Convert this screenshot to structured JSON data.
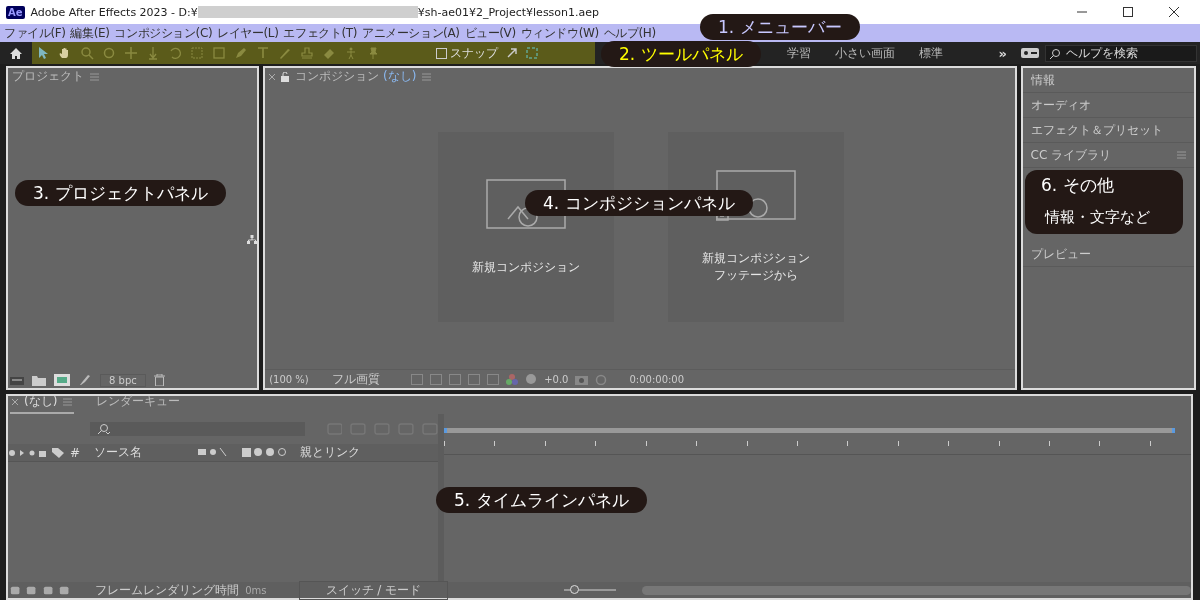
{
  "window": {
    "app_badge": "Ae",
    "title_prefix": "Adobe After Effects 2023 - D:¥",
    "title_suffix": "¥sh-ae01¥2_Project¥lesson1.aep"
  },
  "menu_bar": {
    "items": [
      "ファイル(F)",
      "編集(E)",
      "コンポジション(C)",
      "レイヤー(L)",
      "エフェクト(T)",
      "アニメーション(A)",
      "ビュー(V)",
      "ウィンドウ(W)",
      "ヘルプ(H)"
    ]
  },
  "tool_panel": {
    "snap_label": "スナップ",
    "snap_checked": false,
    "workspaces": [
      {
        "label": "学習",
        "selected": false
      },
      {
        "label": "小さい画面",
        "selected": false
      },
      {
        "label": "標準",
        "selected": false
      }
    ],
    "more": "»",
    "help_search": {
      "placeholder": "ヘルプを検索"
    }
  },
  "project_panel": {
    "title": "プロジェクト",
    "bit_depth": "8 bpc"
  },
  "composition_panel": {
    "tab": "コンポジション",
    "tab_comp": "(なし)",
    "cards": [
      {
        "lines": [
          "新規コンポジション"
        ]
      },
      {
        "lines": [
          "新規コンポジション",
          "フッテージから"
        ]
      }
    ],
    "zoom": "(100 %)",
    "resolution": "フル画質",
    "exposure": "+0.0",
    "timecode": "0:00:00:00"
  },
  "side_panels": {
    "items": [
      {
        "label": "情報",
        "menu": false
      },
      {
        "label": "オーディオ",
        "menu": false
      },
      {
        "label": "エフェクト＆プリセット",
        "menu": false
      },
      {
        "label": "CC ライブラリ",
        "menu": true
      },
      {
        "label": "プレビュー",
        "menu": false
      }
    ]
  },
  "timeline_panel": {
    "tabs": [
      {
        "label": "(なし)",
        "selected": true
      },
      {
        "label": "レンダーキュー",
        "selected": false
      }
    ],
    "columns": [
      "#",
      "ソース名",
      "親とリンク"
    ],
    "frame_render_label": "フレームレンダリング時間",
    "frame_render_time": "0ms",
    "switch_mode": "スイッチ / モード",
    "zoom_slider": {
      "level": 0.2
    }
  },
  "callouts": [
    {
      "lines": [
        "1. メニューバー"
      ],
      "color": "#c8c8ff"
    },
    {
      "lines": [
        "2. ツールパネル"
      ],
      "color": "#ffff00"
    },
    {
      "lines": [
        "3. プロジェクトパネル"
      ],
      "color": "#ffffff"
    },
    {
      "lines": [
        "4. コンポジションパネル"
      ],
      "color": "#ffffff"
    },
    {
      "lines": [
        "5. タイムラインパネル"
      ],
      "color": "#ffffff"
    },
    {
      "lines": [
        "6. その他",
        "情報・文字など"
      ],
      "color": "#ffffff"
    }
  ]
}
